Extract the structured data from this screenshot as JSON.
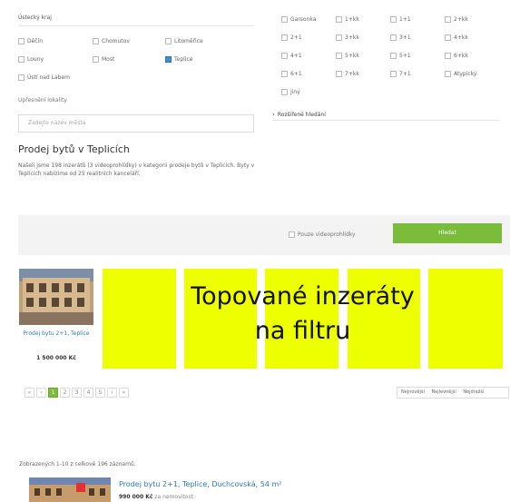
{
  "region": {
    "title": "Ústecký kraj",
    "districts": [
      {
        "label": "Děčín",
        "checked": false
      },
      {
        "label": "Chomutov",
        "checked": false
      },
      {
        "label": "Litoměřice",
        "checked": false
      },
      {
        "label": "Louny",
        "checked": false
      },
      {
        "label": "Most",
        "checked": false
      },
      {
        "label": "Teplice",
        "checked": true
      },
      {
        "label": "Ústí nad Labem",
        "checked": false
      }
    ]
  },
  "locality": {
    "label": "Upřesnění lokality",
    "placeholder": "Zadejte název města"
  },
  "layouts": [
    "Garsonka",
    "1+kk",
    "1+1",
    "2+kk",
    "2+1",
    "3+kk",
    "3+1",
    "4+kk",
    "4+1",
    "5+kk",
    "5+1",
    "6+kk",
    "6+1",
    "7+kk",
    "7+1",
    "Atypický",
    "Jiný"
  ],
  "advanced_search": "Rozšířené hledání",
  "heading": "Prodej bytů v Teplicích",
  "description": "Našeli jsme 198 inzerátů (3 videoprohlídky) v kategorii prodeje bytů v Teplicích. Byty v Teplicích nabízíme od 25 realitních kanceláří.",
  "video_only_label": "Pouze videoprohlídky",
  "search_button": "Hledat",
  "featured": {
    "card_title": "Prodej bytu 2+1, Teplice",
    "card_price": "1 500 000 Kč",
    "overlay": [
      "Topované inzeráty",
      "na filtru"
    ]
  },
  "pagination": {
    "pages": [
      "«",
      "‹",
      "1",
      "2",
      "3",
      "4",
      "5",
      "›",
      "»"
    ],
    "active": "1"
  },
  "sort": [
    "Nejnovější",
    "Nejlevnější",
    "Nejdražší"
  ],
  "results_count": "Zobrazených 1-10 z celkově 196 záznamů.",
  "listing": {
    "title": "Prodej bytu 2+1, Teplice, Duchcovská, 54 m²",
    "price": "990 000 Kč",
    "price_note": "za nemovitost"
  },
  "colors": {
    "accent": "#7bbd3b",
    "link": "#2a79c4",
    "highlight": "#eeff00",
    "selected": "#3d8fd1"
  }
}
